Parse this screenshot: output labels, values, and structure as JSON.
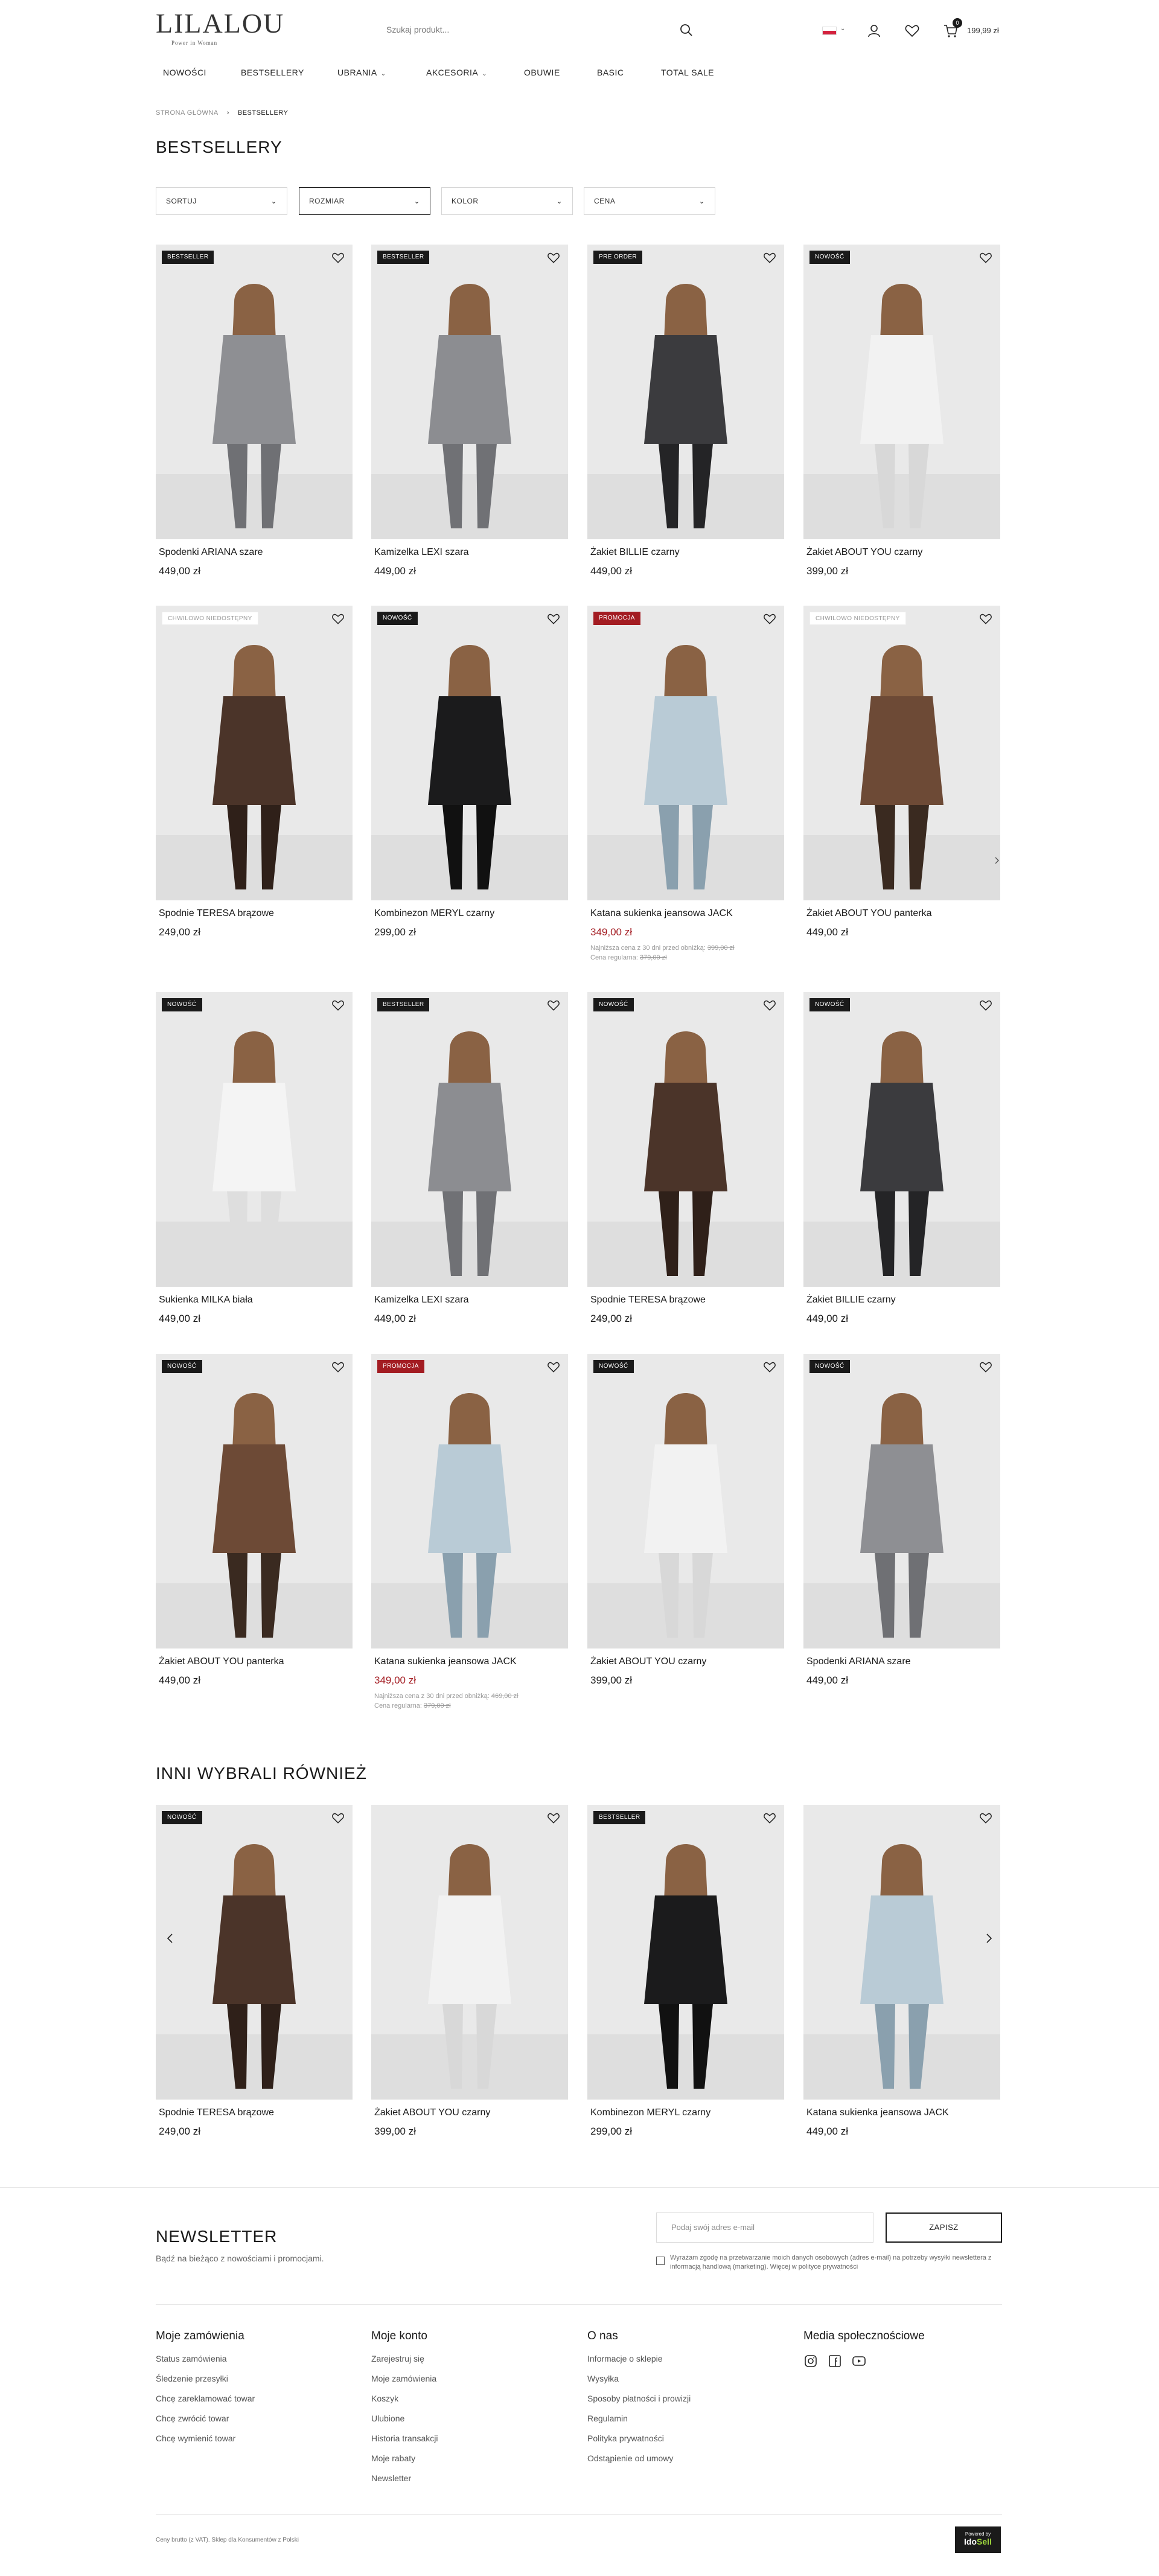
{
  "header": {
    "logo": "LILALOU",
    "tagline": "Power in Woman",
    "search_placeholder": "Szukaj produkt...",
    "cart_count": "0",
    "cart_total": "199,99 zł"
  },
  "nav": [
    "NOWOŚCI",
    "BESTSELLERY",
    "UBRANIA",
    "AKCESORIA",
    "OBUWIE",
    "BASIC",
    "TOTAL SALE"
  ],
  "breadcrumb": {
    "home": "STRONA GŁÓWNA",
    "current": "BESTSELLERY"
  },
  "page_title": "BESTSELLERY",
  "filters": [
    "SORTUJ",
    "ROZMIAR",
    "KOLOR",
    "CENA"
  ],
  "products": [
    {
      "badge": "BESTSELLER",
      "name": "Spodenki ARIANA szare",
      "price": "449,00 zł"
    },
    {
      "badge": "BESTSELLER",
      "name": "Kamizelka LEXI szara",
      "price": "449,00 zł"
    },
    {
      "badge": "PRE ORDER",
      "name": "Żakiet BILLIE czarny",
      "price": "449,00 zł"
    },
    {
      "badge": "NOWOŚĆ",
      "name": "Żakiet ABOUT YOU czarny",
      "price": "399,00 zł"
    },
    {
      "badge": "CHWILOWO NIEDOSTĘPNY",
      "name": "Spodnie TERESA brązowe",
      "price": "249,00 zł"
    },
    {
      "badge": "NOWOŚĆ",
      "name": "Kombinezon MERYL czarny",
      "price": "299,00 zł"
    },
    {
      "badge": "PROMOCJA",
      "name": "Katana sukienka jeansowa JACK",
      "price": "349,00 zł",
      "note1": "Najniższa cena z 30 dni przed obniżką:",
      "old1": "399,00 zł",
      "note2": "Cena regularna:",
      "old2": "379,00 zł"
    },
    {
      "badge": "CHWILOWO NIEDOSTĘPNY",
      "name": "Żakiet ABOUT YOU panterka",
      "price": "449,00 zł"
    },
    {
      "badge": "NOWOŚĆ",
      "name": "Sukienka MILKA biała",
      "price": "449,00 zł"
    },
    {
      "badge": "BESTSELLER",
      "name": "Kamizelka LEXI szara",
      "price": "449,00 zł"
    },
    {
      "badge": "NOWOŚĆ",
      "name": "Spodnie TERESA brązowe",
      "price": "249,00 zł"
    },
    {
      "badge": "NOWOŚĆ",
      "name": "Żakiet BILLIE czarny",
      "price": "449,00 zł"
    },
    {
      "badge": "NOWOŚĆ",
      "name": "Żakiet ABOUT YOU panterka",
      "price": "449,00 zł"
    },
    {
      "badge": "PROMOCJA",
      "name": "Katana sukienka jeansowa JACK",
      "price": "349,00 zł",
      "note1": "Najniższa cena z 30 dni przed obniżką:",
      "old1": "469,00 zł",
      "note2": "Cena regularna:",
      "old2": "379,00 zł"
    },
    {
      "badge": "NOWOŚĆ",
      "name": "Żakiet ABOUT YOU czarny",
      "price": "399,00 zł"
    },
    {
      "badge": "NOWOŚĆ",
      "name": "Spodenki ARIANA szare",
      "price": "449,00 zł"
    }
  ],
  "also_title": "INNI WYBRALI RÓWNIEŻ",
  "also": [
    {
      "badge": "NOWOŚĆ",
      "name": "Spodnie TERESA brązowe",
      "price": "249,00 zł"
    },
    {
      "badge": "",
      "name": "Żakiet ABOUT YOU czarny",
      "price": "399,00 zł"
    },
    {
      "badge": "BESTSELLER",
      "name": "Kombinezon MERYL czarny",
      "price": "299,00 zł"
    },
    {
      "badge": "",
      "name": "Katana sukienka jeansowa JACK",
      "price": "449,00 zł"
    }
  ],
  "newsletter": {
    "title": "NEWSLETTER",
    "subtitle": "Bądź na bieżąco z nowościami i promocjami.",
    "placeholder": "Podaj swój adres e-mail",
    "button": "ZAPISZ",
    "consent": "Wyrażam zgodę na przetwarzanie moich danych osobowych (adres e-mail) na potrzeby wysyłki newslettera z informacją handlową (marketing). Więcej w polityce prywatności"
  },
  "footer": {
    "col1": {
      "title": "Moje zamówienia",
      "links": [
        "Status zamówienia",
        "Śledzenie przesyłki",
        "Chcę zareklamować towar",
        "Chcę zwrócić towar",
        "Chcę wymienić towar"
      ]
    },
    "col2": {
      "title": "Moje konto",
      "links": [
        "Zarejestruj się",
        "Moje zamówienia",
        "Koszyk",
        "Ulubione",
        "Historia transakcji",
        "Moje rabaty",
        "Newsletter"
      ]
    },
    "col3": {
      "title": "O nas",
      "links": [
        "Informacje o sklepie",
        "Wysyłka",
        "Sposoby płatności i prowizji",
        "Regulamin",
        "Polityka prywatności",
        "Odstąpienie od umowy"
      ]
    },
    "col4": {
      "title": "Media społecznościowe",
      "icons": [
        "instagram-icon",
        "facebook-icon",
        "youtube-icon"
      ]
    },
    "legal": "Ceny brutto (z VAT). Sklep dla Konsumentów z Polski",
    "powered_by": "Powered by",
    "powered_brand_a": "Ido",
    "powered_brand_b": "Sell"
  },
  "colors": {
    "promo": "#a31c22",
    "accent": "#1a1a1a",
    "idosell_green": "#9bd23c"
  }
}
